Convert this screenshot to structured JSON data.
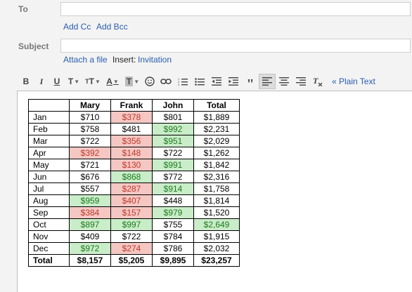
{
  "compose": {
    "to_label": "To",
    "add_cc": "Add Cc",
    "add_bcc": "Add Bcc",
    "subject_label": "Subject",
    "attach_file": "Attach a file",
    "insert_label": "Insert:",
    "invitation": "Invitation",
    "plain_text": "« Plain Text"
  },
  "toolbar": {
    "bold": "B",
    "italic": "I",
    "underline": "U",
    "font": "T",
    "size": "T",
    "text_color": "A",
    "bg_color": "T"
  },
  "colors": {
    "red_bg": "#f4c7c3",
    "red_text": "#c0392b",
    "green_bg": "#c9ecc9",
    "green_text": "#1e7a1e",
    "link": "#2a5db0"
  },
  "table": {
    "headers": [
      "",
      "Mary",
      "Frank",
      "John",
      "Total"
    ],
    "rows": [
      {
        "month": "Jan",
        "mary": "$710",
        "frank": "$378",
        "john": "$801",
        "total": "$1,889"
      },
      {
        "month": "Feb",
        "mary": "$758",
        "frank": "$481",
        "john": "$992",
        "total": "$2,231"
      },
      {
        "month": "Mar",
        "mary": "$722",
        "frank": "$356",
        "john": "$951",
        "total": "$2,029"
      },
      {
        "month": "Apr",
        "mary": "$392",
        "frank": "$148",
        "john": "$722",
        "total": "$1,262"
      },
      {
        "month": "May",
        "mary": "$721",
        "frank": "$130",
        "john": "$991",
        "total": "$1,842"
      },
      {
        "month": "Jun",
        "mary": "$676",
        "frank": "$868",
        "john": "$772",
        "total": "$2,316"
      },
      {
        "month": "Jul",
        "mary": "$557",
        "frank": "$287",
        "john": "$914",
        "total": "$1,758"
      },
      {
        "month": "Aug",
        "mary": "$959",
        "frank": "$407",
        "john": "$448",
        "total": "$1,814"
      },
      {
        "month": "Sep",
        "mary": "$384",
        "frank": "$157",
        "john": "$979",
        "total": "$1,520"
      },
      {
        "month": "Oct",
        "mary": "$897",
        "frank": "$997",
        "john": "$755",
        "total": "$2,649"
      },
      {
        "month": "Nov",
        "mary": "$409",
        "frank": "$722",
        "john": "$784",
        "total": "$1,915"
      },
      {
        "month": "Dec",
        "mary": "$972",
        "frank": "$274",
        "john": "$786",
        "total": "$2,032"
      }
    ],
    "total": {
      "month": "Total",
      "mary": "$8,157",
      "frank": "$5,205",
      "john": "$9,895",
      "total": "$23,257"
    },
    "highlight": {
      "Jan": {
        "frank": "red"
      },
      "Feb": {
        "john": "green"
      },
      "Mar": {
        "frank": "red",
        "john": "green"
      },
      "Apr": {
        "mary": "red",
        "frank": "red"
      },
      "May": {
        "frank": "red",
        "john": "green"
      },
      "Jun": {
        "frank": "green"
      },
      "Jul": {
        "frank": "red",
        "john": "green"
      },
      "Aug": {
        "mary": "green",
        "frank": "red"
      },
      "Sep": {
        "mary": "red",
        "frank": "red",
        "john": "green"
      },
      "Oct": {
        "mary": "green",
        "frank": "green",
        "total": "green"
      },
      "Dec": {
        "mary": "green",
        "frank": "red"
      }
    }
  }
}
